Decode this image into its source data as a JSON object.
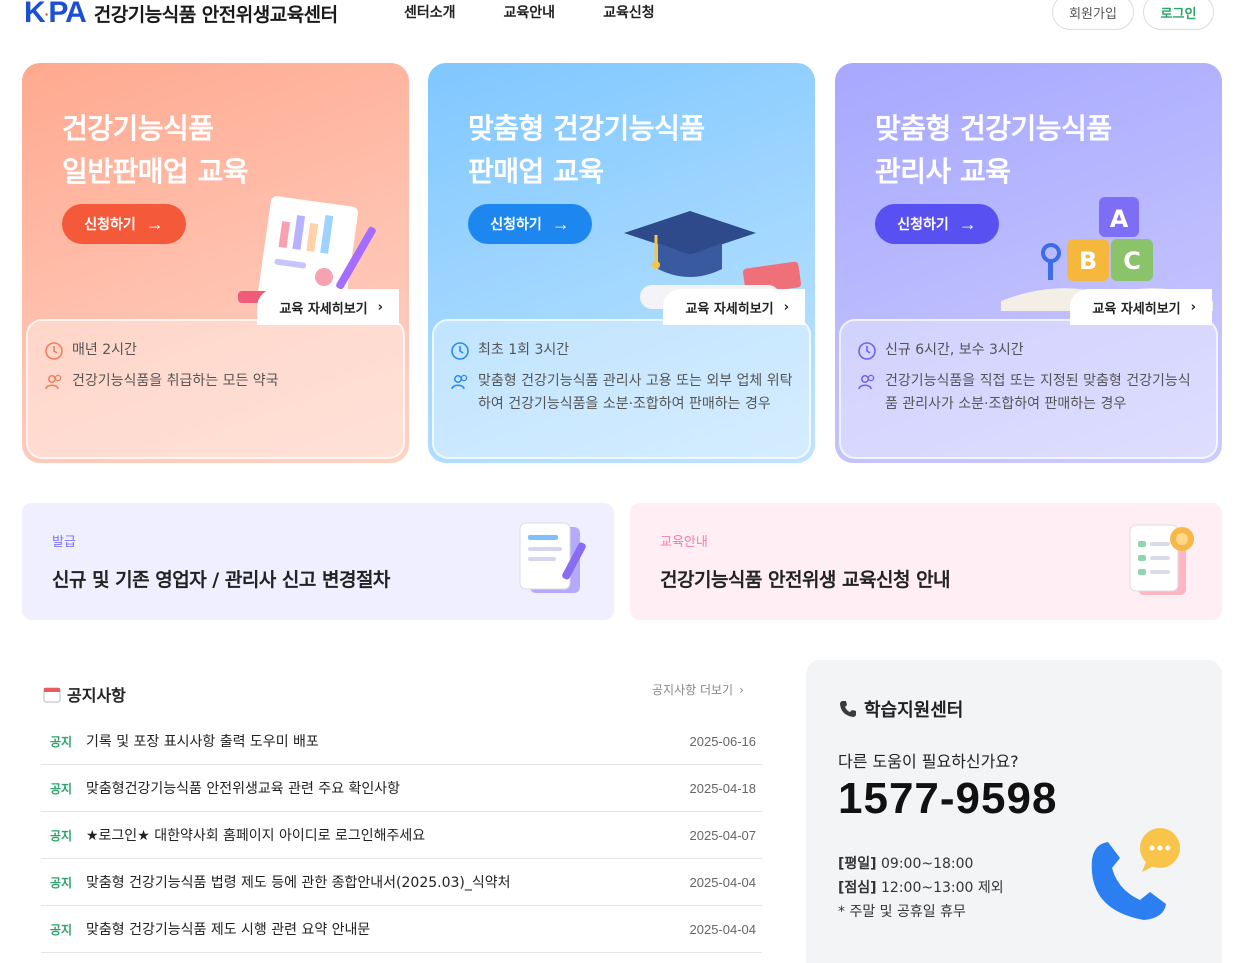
{
  "header": {
    "logo_mark": "K",
    "logo_mark_rest": "PA",
    "site_title": "건강기능식품 안전위생교육센터",
    "nav": [
      "센터소개",
      "교육안내",
      "교육신청"
    ],
    "join_label": "회원가입",
    "login_label": "로그인"
  },
  "cards": [
    {
      "title_line1": "건강기능식품",
      "title_line2": "일반판매업 교육",
      "apply_label": "신청하기",
      "detail_label": "교육 자세히보기",
      "time": "매년 2시간",
      "target": "건강기능식품을 취급하는 모든 약국",
      "accent": "#f45a3a"
    },
    {
      "title_line1": "맞춤형 건강기능식품",
      "title_line2": "판매업 교육",
      "apply_label": "신청하기",
      "detail_label": "교육 자세히보기",
      "time": "최초 1회 3시간",
      "target": "맞춤형 건강기능식품 관리사 고용 또는 외부 업체 위탁하여 건강기능식품을 소분·조합하여 판매하는 경우",
      "accent": "#1d86ef"
    },
    {
      "title_line1": "맞춤형 건강기능식품",
      "title_line2": "관리사 교육",
      "apply_label": "신청하기",
      "detail_label": "교육 자세히보기",
      "time": "신규 6시간, 보수 3시간",
      "target": "건강기능식품을 직접 또는 지정된 맞춤형 건강기능식품 관리사가 소분·조합하여 판매하는 경우",
      "accent": "#5850f0"
    }
  ],
  "banners": [
    {
      "tag": "발급",
      "title": "신규 및 기존 영업자 / 관리사 신고 변경절차"
    },
    {
      "tag": "교육안내",
      "title": "건강기능식품 안전위생 교육신청 안내"
    }
  ],
  "notices": {
    "title": "공지사항",
    "more_label": "공지사항 더보기",
    "items": [
      {
        "badge": "공지",
        "text": "기록 및 포장 표시사항 출력 도우미 배포",
        "date": "2025-06-16"
      },
      {
        "badge": "공지",
        "text": "맞춤형건강기능식품 안전위생교육 관련 주요 확인사항",
        "date": "2025-04-18"
      },
      {
        "badge": "공지",
        "text": "★로그인★ 대한약사회 홈페이지 아이디로 로그인해주세요",
        "date": "2025-04-07"
      },
      {
        "badge": "공지",
        "text": "맞춤형 건강기능식품 법령 제도 등에 관한 종합안내서(2025.03)_식약처",
        "date": "2025-04-04"
      },
      {
        "badge": "공지",
        "text": "맞춤형 건강기능식품 제도 시행 관련 요약 안내문",
        "date": "2025-04-04"
      }
    ]
  },
  "support": {
    "title": "학습지원센터",
    "question": "다른 도움이 필요하신가요?",
    "phone": "1577-9598",
    "weekday_label": "[평일]",
    "weekday_hours": "09:00~18:00",
    "lunch_label": "[점심]",
    "lunch_hours": "12:00~13:00 제외",
    "holiday_note": "* 주말 및 공휴일 휴무"
  }
}
